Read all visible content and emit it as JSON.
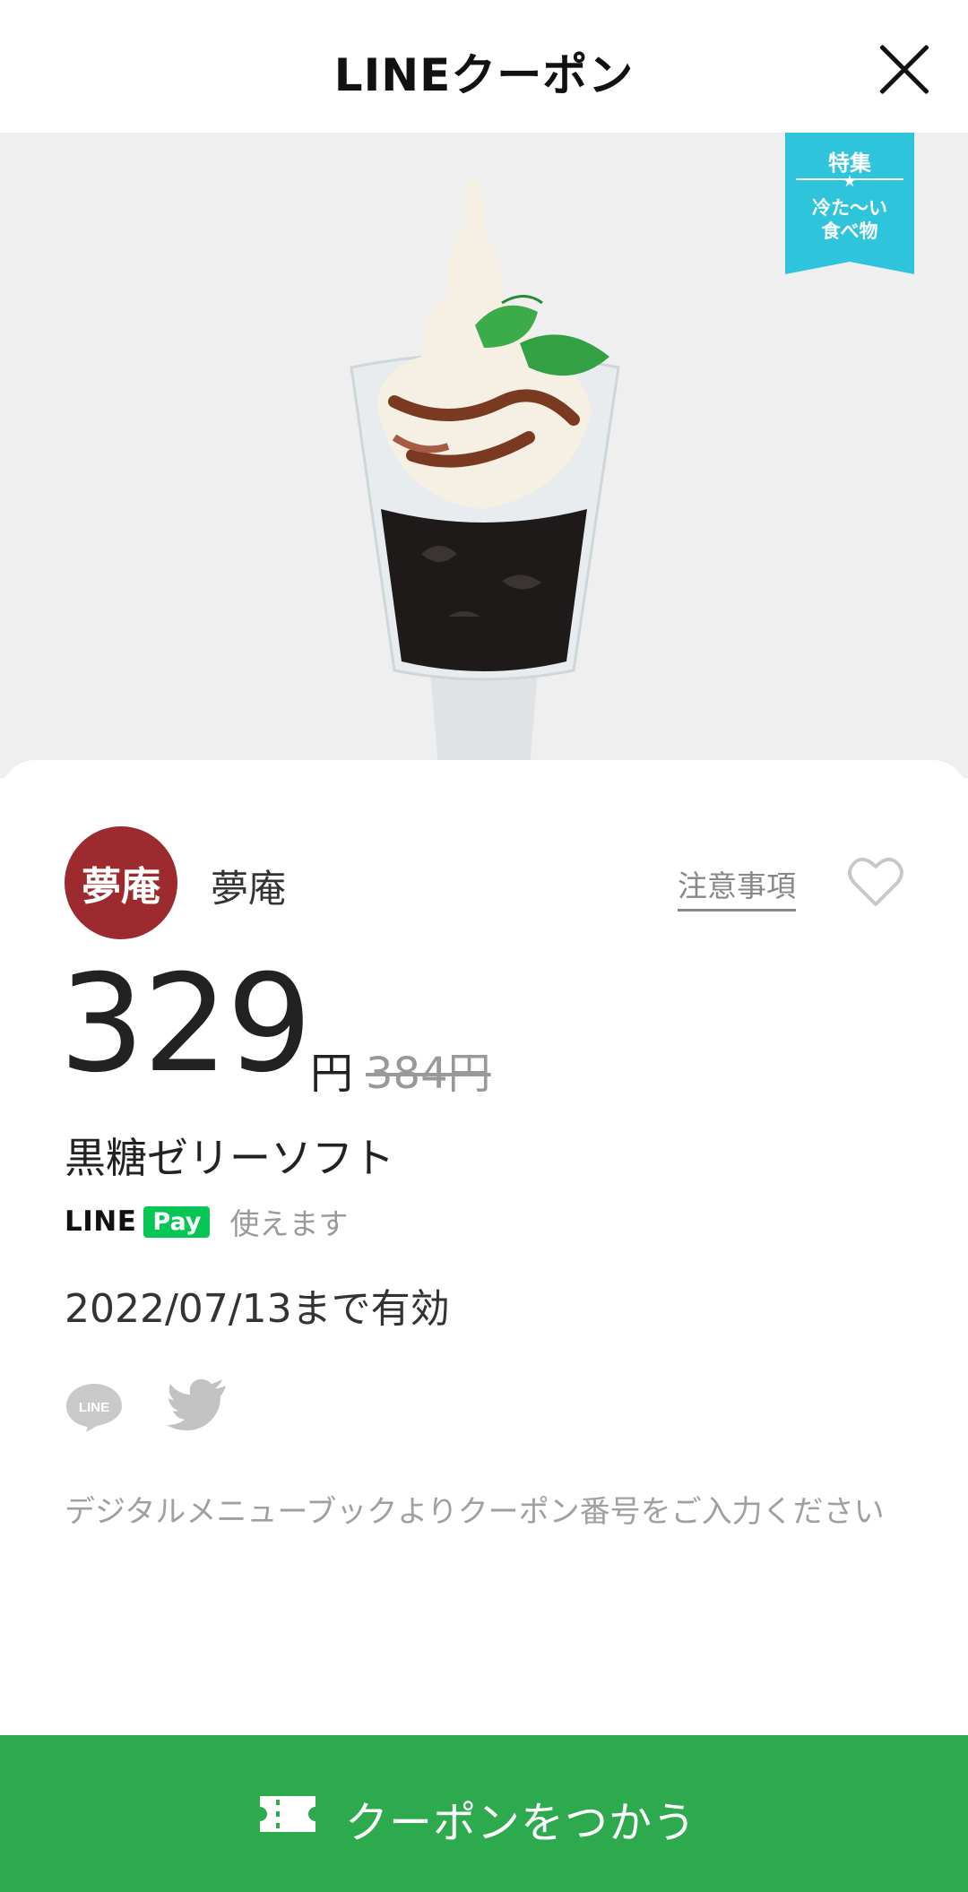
{
  "header": {
    "title": "LINEクーポン",
    "close_icon": "close-icon"
  },
  "banner": {
    "line1": "特集",
    "star": "★",
    "line2": "冷た〜い",
    "line3": "食べ物",
    "color": "#2ec4dc"
  },
  "shop": {
    "logo_text": "夢庵",
    "name": "夢庵",
    "notes_link": "注意事項",
    "favorite_icon": "heart-icon",
    "logo_color": "#9c2a2e"
  },
  "offer": {
    "price": "329",
    "currency": "円",
    "original_price": "384円",
    "item_name": "黒糖ゼリーソフト",
    "linepay_line": "LINE",
    "linepay_pay": "Pay",
    "linepay_note": "使えます",
    "valid_until": "2022/07/13まで有効"
  },
  "share": {
    "line_label": "LINE",
    "line_icon": "line-share-icon",
    "twitter_icon": "twitter-icon"
  },
  "notice": "デジタルメニューブックよりクーポン番号をご入力ください",
  "cta": {
    "label": "クーポンをつかう",
    "icon": "ticket-icon",
    "color": "#2eaa4e"
  }
}
